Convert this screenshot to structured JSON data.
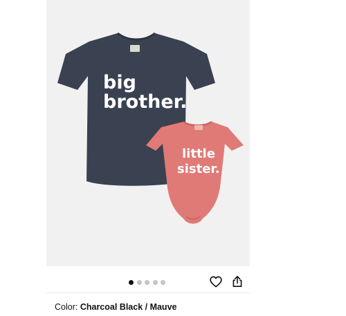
{
  "product": {
    "image": {
      "shirt_text_line1": "big",
      "shirt_text_line2": "brother.",
      "bodysuit_text_line1": "little",
      "bodysuit_text_line2": "sister.",
      "shirt_color": "#3a4150",
      "bodysuit_color": "#e07a76",
      "background_color": "#f1f1f1"
    },
    "carousel": {
      "total": 5,
      "active_index": 0
    },
    "actions": {
      "favorite_icon": "heart-icon",
      "share_icon": "share-icon"
    },
    "color": {
      "label": "Color:",
      "value": "Charcoal Black / Mauve"
    }
  }
}
